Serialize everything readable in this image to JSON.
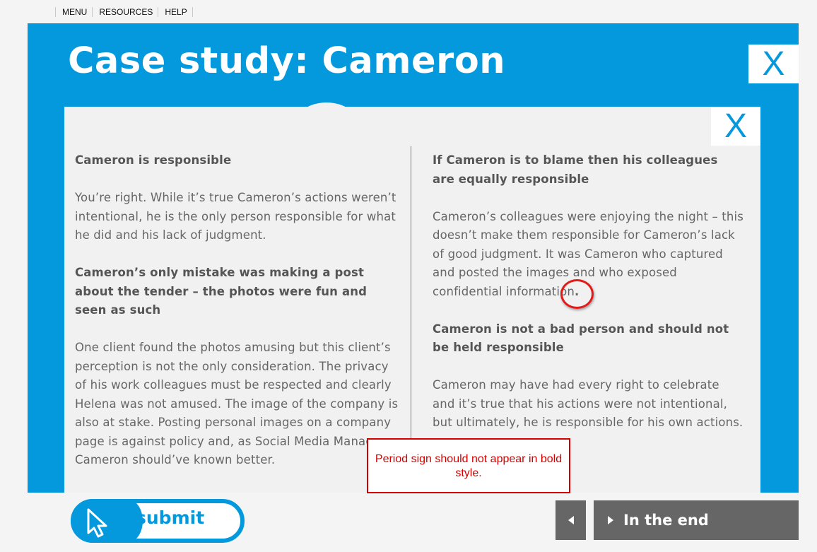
{
  "menu": {
    "items": [
      "MENU",
      "RESOURCES",
      "HELP"
    ]
  },
  "header": {
    "title": "Case study: Cameron",
    "close_label": "X"
  },
  "panel": {
    "close_label": "X",
    "left": [
      {
        "heading": "Cameron is responsible",
        "body": "You’re right. While it’s true Cameron’s actions weren’t intentional, he is the only person responsible for what he did and his lack of judgment."
      },
      {
        "heading": "Cameron’s only mistake was making a post about the tender – the photos were fun and seen as such",
        "body": "One client found the photos amusing but this client’s perception is not the only consideration. The privacy of his work colleagues must be respected and clearly Helena was not amused. The image of the company is also at stake. Posting personal images on a company page is against policy and, as Social Media Manager, Cameron should’ve known better."
      }
    ],
    "right": [
      {
        "heading": "If Cameron is to blame then his colleagues are equally responsible",
        "body": "Cameron’s colleagues were enjoying the night – this doesn’t make them responsible for Cameron’s lack of good judgment. It was Cameron who captured and posted the images and who exposed confidential information",
        "trailing": "."
      },
      {
        "heading": "Cameron is not a bad person and should not be held responsible",
        "body": "Cameron may have had every right to celebrate and it’s true that his actions were not intentional, but ultimately, he is responsible for his own actions."
      }
    ]
  },
  "annotation": {
    "note": "Period sign should not appear in bold style.",
    "color": "#d40000"
  },
  "footer": {
    "submit_label": "submit",
    "next_label": "In the end",
    "prev_icon": "triangle-left-icon",
    "next_icon": "triangle-right-icon"
  },
  "colors": {
    "brand_blue": "#0399dc",
    "panel_bg": "#f1f1f1",
    "nav_gray": "#666666"
  }
}
